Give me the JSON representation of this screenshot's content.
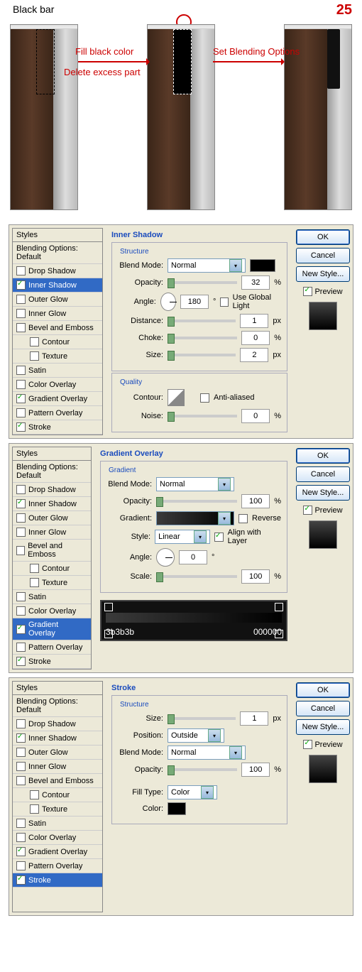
{
  "top": {
    "title": "Black bar",
    "step": "25",
    "annot1a": "Fill black color",
    "annot1b": "Delete excess part",
    "annot2": "Set Blending Options"
  },
  "styles_header": "Styles",
  "bo_default": "Blending Options: Default",
  "effects": {
    "drop_shadow": "Drop Shadow",
    "inner_shadow": "Inner Shadow",
    "outer_glow": "Outer Glow",
    "inner_glow": "Inner Glow",
    "bevel": "Bevel and Emboss",
    "contour": "Contour",
    "texture": "Texture",
    "satin": "Satin",
    "color_overlay": "Color Overlay",
    "gradient_overlay": "Gradient Overlay",
    "pattern_overlay": "Pattern Overlay",
    "stroke": "Stroke"
  },
  "btns": {
    "ok": "OK",
    "cancel": "Cancel",
    "new_style": "New Style...",
    "preview": "Preview"
  },
  "p1": {
    "title": "Inner Shadow",
    "structure": "Structure",
    "blend_mode": "Blend Mode:",
    "blend_val": "Normal",
    "opacity": "Opacity:",
    "opacity_val": "32",
    "pct": "%",
    "angle": "Angle:",
    "angle_val": "180",
    "deg": "°",
    "ugl": "Use Global Light",
    "distance": "Distance:",
    "distance_val": "1",
    "px": "px",
    "choke": "Choke:",
    "choke_val": "0",
    "size": "Size:",
    "size_val": "2",
    "quality": "Quality",
    "contour": "Contour:",
    "aa": "Anti-aliased",
    "noise": "Noise:",
    "noise_val": "0"
  },
  "p2": {
    "title": "Gradient Overlay",
    "gradient": "Gradient",
    "blend_mode": "Blend Mode:",
    "blend_val": "Normal",
    "opacity": "Opacity:",
    "opacity_val": "100",
    "pct": "%",
    "grad_lbl": "Gradient:",
    "reverse": "Reverse",
    "style": "Style:",
    "style_val": "Linear",
    "align": "Align with Layer",
    "angle": "Angle:",
    "angle_val": "0",
    "deg": "°",
    "scale": "Scale:",
    "scale_val": "100",
    "stop_left": "3b3b3b",
    "stop_right": "000000"
  },
  "p3": {
    "title": "Stroke",
    "structure": "Structure",
    "size": "Size:",
    "size_val": "1",
    "px": "px",
    "position": "Position:",
    "position_val": "Outside",
    "blend_mode": "Blend Mode:",
    "blend_val": "Normal",
    "opacity": "Opacity:",
    "opacity_val": "100",
    "pct": "%",
    "fill_type": "Fill Type:",
    "fill_val": "Color",
    "color": "Color:"
  }
}
